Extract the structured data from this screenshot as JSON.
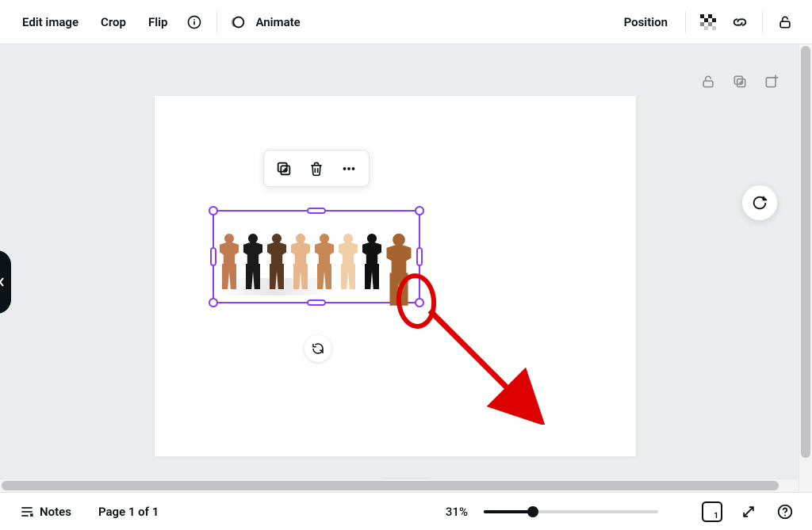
{
  "toolbar": {
    "edit_image": "Edit image",
    "crop": "Crop",
    "flip": "Flip",
    "animate": "Animate",
    "position": "Position"
  },
  "figure_colors": [
    "#c07b50",
    "#1a1a1a",
    "#5b3a22",
    "#e6b58a",
    "#c78853",
    "#f0cfa8",
    "#111111",
    "#a5632f"
  ],
  "footer": {
    "notes": "Notes",
    "page_label": "Page 1 of 1",
    "zoom_label": "31%",
    "page_badge": "1"
  }
}
